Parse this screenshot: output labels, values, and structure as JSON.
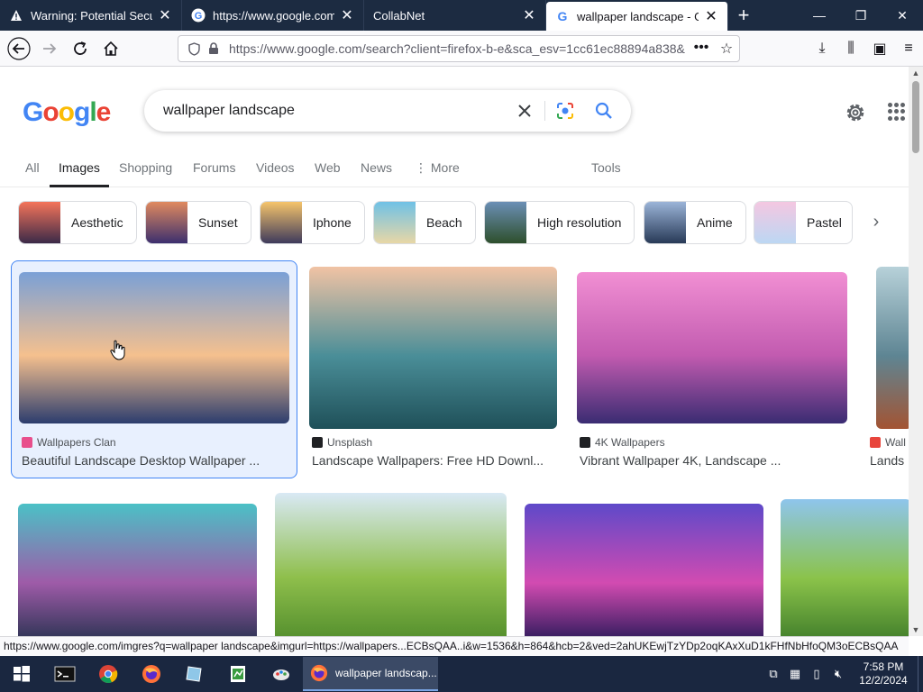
{
  "browser": {
    "tabs": [
      {
        "label": "Warning: Potential Security",
        "active": false
      },
      {
        "label": "https://www.google.com/",
        "active": false
      },
      {
        "label": "CollabNet",
        "active": false
      },
      {
        "label": "wallpaper landscape - Goo",
        "active": true
      }
    ],
    "url": "https://www.google.com/search?client=firefox-b-e&sca_esv=1cc61ec88894a838&",
    "status_url": "https://www.google.com/imgres?q=wallpaper landscape&imgurl=https://wallpapers...ECBsQAA..i&w=1536&h=864&hcb=2&ved=2ahUKEwjTzYDp2oqKAxXuD1kFHfNbHfoQM3oECBsQAA"
  },
  "search": {
    "query": "wallpaper landscape"
  },
  "tabs": [
    {
      "label": "All",
      "active": false
    },
    {
      "label": "Images",
      "active": true
    },
    {
      "label": "Shopping",
      "active": false
    },
    {
      "label": "Forums",
      "active": false
    },
    {
      "label": "Videos",
      "active": false
    },
    {
      "label": "Web",
      "active": false
    },
    {
      "label": "News",
      "active": false
    },
    {
      "label": "⋮ More",
      "active": false
    },
    {
      "label": "Tools",
      "active": false
    }
  ],
  "chips": [
    {
      "label": "Aesthetic",
      "colors": [
        "#f4745a",
        "#3b2a48"
      ]
    },
    {
      "label": "Sunset",
      "colors": [
        "#e08a5f",
        "#3c2f6e"
      ]
    },
    {
      "label": "Iphone",
      "colors": [
        "#f6c46b",
        "#3e3a5c"
      ]
    },
    {
      "label": "Beach",
      "colors": [
        "#6fc1e6",
        "#e8d7a6"
      ]
    },
    {
      "label": "High resolution",
      "colors": [
        "#6b8fb5",
        "#2e4f2c"
      ]
    },
    {
      "label": "Anime",
      "colors": [
        "#9bb4d8",
        "#283a57"
      ]
    },
    {
      "label": "Pastel",
      "colors": [
        "#f4c7e1",
        "#bcd7f3"
      ]
    }
  ],
  "results": [
    {
      "source": "Wallpapers Clan",
      "title": "Beautiful Landscape Desktop Wallpaper ...",
      "colors": [
        "#7aa0d6",
        "#f5c08e",
        "#2c3d6e"
      ],
      "icon_color": "#e84f8c"
    },
    {
      "source": "Unsplash",
      "title": "Landscape Wallpapers: Free HD Downl...",
      "colors": [
        "#f1c3a4",
        "#4a8e98",
        "#1f5059"
      ],
      "icon_color": "#202124"
    },
    {
      "source": "4K Wallpapers",
      "title": "Vibrant Wallpaper 4K, Landscape ...",
      "colors": [
        "#f18fd3",
        "#c25bb0",
        "#3a2c72"
      ],
      "icon_color": "#202124"
    },
    {
      "source": "Wall",
      "title": "Lands",
      "colors": [
        "#b7d1d9",
        "#5e8593",
        "#a35433"
      ],
      "icon_color": "#e8453c"
    },
    {
      "colors": [
        "#4bc1c6",
        "#9e5ba8",
        "#1f2f4a"
      ]
    },
    {
      "colors": [
        "#d9e9f5",
        "#8fbf4c",
        "#4e8a2a"
      ]
    },
    {
      "colors": [
        "#5e49c9",
        "#d24bb1",
        "#1b1552"
      ]
    },
    {
      "colors": [
        "#8ec5ec",
        "#8bc34a",
        "#3f7c2a"
      ]
    }
  ],
  "taskbar": {
    "active_label": "wallpaper landscap...",
    "time": "7:58 PM",
    "date": "12/2/2024"
  }
}
